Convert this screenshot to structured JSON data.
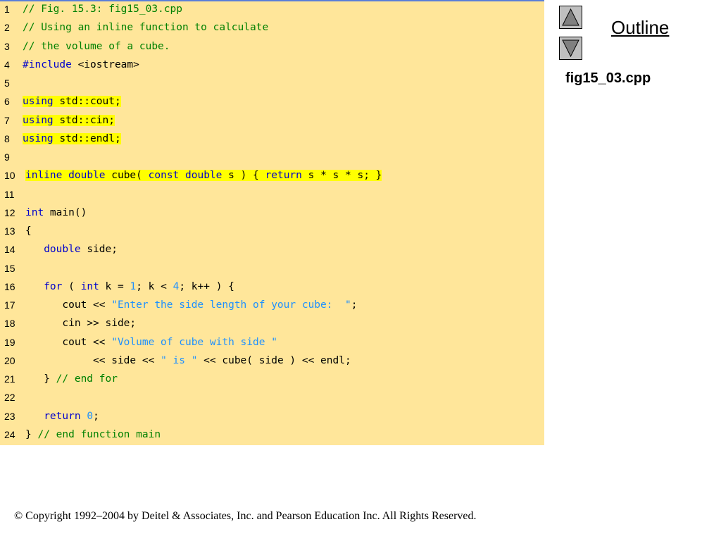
{
  "nav": {
    "outline_label": "Outline",
    "up_icon": "triangle-up-icon",
    "down_icon": "triangle-down-icon"
  },
  "file_title": "fig15_03.cpp",
  "copyright": "© Copyright 1992–2004 by Deitel & Associates, Inc. and Pearson Education Inc. All Rights Reserved.",
  "colors": {
    "code_background": "#ffe69a",
    "highlight": "#ffff00",
    "comment": "#008000",
    "keyword": "#0000cc",
    "string": "#1e90ff"
  },
  "code": {
    "lines": [
      {
        "n": "1",
        "tokens": [
          {
            "t": "// Fig. 15.3: fig15_03.cpp",
            "k": "comment"
          }
        ]
      },
      {
        "n": "2",
        "tokens": [
          {
            "t": "// Using an inline function to calculate",
            "k": "comment"
          }
        ]
      },
      {
        "n": "3",
        "tokens": [
          {
            "t": "// the volume of a cube.",
            "k": "comment"
          }
        ]
      },
      {
        "n": "4",
        "tokens": [
          {
            "t": "#include",
            "k": "kw"
          },
          {
            "t": " <iostream>",
            "k": "plain"
          }
        ]
      },
      {
        "n": "5",
        "tokens": []
      },
      {
        "n": "6",
        "hl": true,
        "tokens": [
          {
            "t": "using",
            "k": "kw"
          },
          {
            "t": " std::cout;",
            "k": "plain"
          }
        ]
      },
      {
        "n": "7",
        "hl": true,
        "tokens": [
          {
            "t": "using",
            "k": "kw"
          },
          {
            "t": " std::cin;",
            "k": "plain"
          }
        ]
      },
      {
        "n": "8",
        "hl": true,
        "tokens": [
          {
            "t": "using",
            "k": "kw"
          },
          {
            "t": " std::endl;",
            "k": "plain"
          }
        ]
      },
      {
        "n": "9",
        "tokens": []
      },
      {
        "n": "10",
        "hl": true,
        "tokens": [
          {
            "t": "inline",
            "k": "kw"
          },
          {
            "t": " ",
            "k": "plain"
          },
          {
            "t": "double",
            "k": "kw"
          },
          {
            "t": " cube( ",
            "k": "plain"
          },
          {
            "t": "const",
            "k": "kw"
          },
          {
            "t": " ",
            "k": "plain"
          },
          {
            "t": "double",
            "k": "kw"
          },
          {
            "t": " s ) { ",
            "k": "plain"
          },
          {
            "t": "return",
            "k": "kw"
          },
          {
            "t": " s * s * s; }",
            "k": "plain"
          }
        ]
      },
      {
        "n": "11",
        "tokens": []
      },
      {
        "n": "12",
        "tokens": [
          {
            "t": "int",
            "k": "kw"
          },
          {
            "t": " main()",
            "k": "plain"
          }
        ]
      },
      {
        "n": "13",
        "tokens": [
          {
            "t": "{",
            "k": "plain"
          }
        ]
      },
      {
        "n": "14",
        "tokens": [
          {
            "t": "   ",
            "k": "plain"
          },
          {
            "t": "double",
            "k": "kw"
          },
          {
            "t": " side;",
            "k": "plain"
          }
        ]
      },
      {
        "n": "15",
        "tokens": []
      },
      {
        "n": "16",
        "tokens": [
          {
            "t": "   ",
            "k": "plain"
          },
          {
            "t": "for",
            "k": "kw"
          },
          {
            "t": " ( ",
            "k": "plain"
          },
          {
            "t": "int",
            "k": "kw"
          },
          {
            "t": " k = ",
            "k": "plain"
          },
          {
            "t": "1",
            "k": "num"
          },
          {
            "t": "; k < ",
            "k": "plain"
          },
          {
            "t": "4",
            "k": "num"
          },
          {
            "t": "; k++ ) {",
            "k": "plain"
          }
        ]
      },
      {
        "n": "17",
        "tokens": [
          {
            "t": "      cout << ",
            "k": "plain"
          },
          {
            "t": "\"Enter the side length of your cube:  \"",
            "k": "str"
          },
          {
            "t": ";",
            "k": "plain"
          }
        ]
      },
      {
        "n": "18",
        "tokens": [
          {
            "t": "      cin >> side;",
            "k": "plain"
          }
        ]
      },
      {
        "n": "19",
        "tokens": [
          {
            "t": "      cout << ",
            "k": "plain"
          },
          {
            "t": "\"Volume of cube with side \"",
            "k": "str"
          }
        ]
      },
      {
        "n": "20",
        "tokens": [
          {
            "t": "           << side << ",
            "k": "plain"
          },
          {
            "t": "\" is \"",
            "k": "str"
          },
          {
            "t": " << cube( side ) << endl;",
            "k": "plain"
          }
        ]
      },
      {
        "n": "21",
        "tokens": [
          {
            "t": "   } ",
            "k": "plain"
          },
          {
            "t": "// end for",
            "k": "comment"
          }
        ]
      },
      {
        "n": "22",
        "tokens": []
      },
      {
        "n": "23",
        "tokens": [
          {
            "t": "   ",
            "k": "plain"
          },
          {
            "t": "return",
            "k": "kw"
          },
          {
            "t": " ",
            "k": "plain"
          },
          {
            "t": "0",
            "k": "num"
          },
          {
            "t": ";",
            "k": "plain"
          }
        ]
      },
      {
        "n": "24",
        "tokens": [
          {
            "t": "} ",
            "k": "plain"
          },
          {
            "t": "// end function main",
            "k": "comment"
          }
        ]
      }
    ]
  }
}
